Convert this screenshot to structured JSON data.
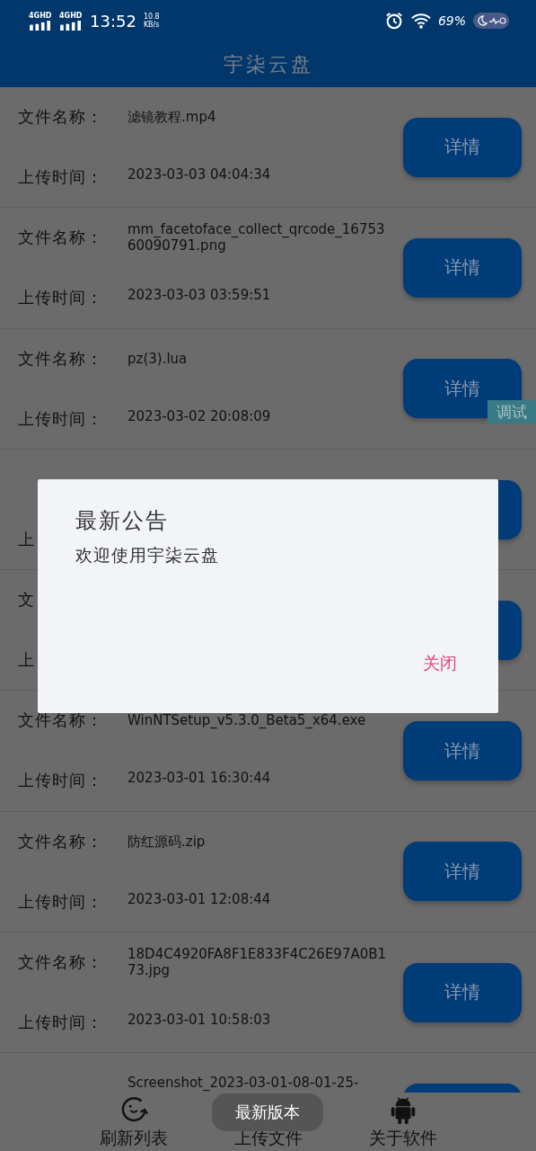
{
  "status_bar": {
    "network_1": "4GHD",
    "network_2": "4GHD",
    "time": "13:52",
    "speed": "10.8",
    "speed_unit": "KB/s",
    "battery": "69%"
  },
  "header": {
    "title": "宇柒云盘"
  },
  "files": [
    {
      "name_label": "文件名称：",
      "name": "滤镜教程.mp4",
      "time_label": "上传时间：",
      "time": "2023-03-03 04:04:34",
      "button": "详情"
    },
    {
      "name_label": "文件名称：",
      "name": "mm_facetoface_collect_qrcode_1675360090791.png",
      "time_label": "上传时间：",
      "time": "2023-03-03 03:59:51",
      "button": "详情"
    },
    {
      "name_label": "文件名称：",
      "name": "pz(3).lua",
      "time_label": "上传时间：",
      "time": "2023-03-02 20:08:09",
      "button": "详情"
    },
    {
      "time_label": "上"
    },
    {
      "name_label": "文",
      "time_label": "上"
    },
    {
      "name_label": "文件名称：",
      "name": "WinNTSetup_v5.3.0_Beta5_x64.exe",
      "time_label": "上传时间：",
      "time": "2023-03-01 16:30:44",
      "button": "详情"
    },
    {
      "name_label": "文件名称：",
      "name": "防红源码.zip",
      "time_label": "上传时间：",
      "time": "2023-03-01 12:08:44",
      "button": "详情"
    },
    {
      "name_label": "文件名称：",
      "name": "18D4C4920FA8F1E833F4C26E97A0B173.jpg",
      "time_label": "上传时间：",
      "time": "2023-03-01 10:58:03",
      "button": "详情"
    },
    {
      "name": "Screenshot_2023-03-01-08-01-25-"
    }
  ],
  "debug_badge": "调试",
  "dialog": {
    "title": "最新公告",
    "message": "欢迎使用宇柒云盘",
    "close_button": "关闭"
  },
  "bottom_nav": [
    {
      "label": "刷新列表",
      "kind": "refresh"
    },
    {
      "label": "上传文件",
      "kind": "plain"
    },
    {
      "label": "关于软件",
      "kind": "android"
    }
  ],
  "toast": "最新版本"
}
